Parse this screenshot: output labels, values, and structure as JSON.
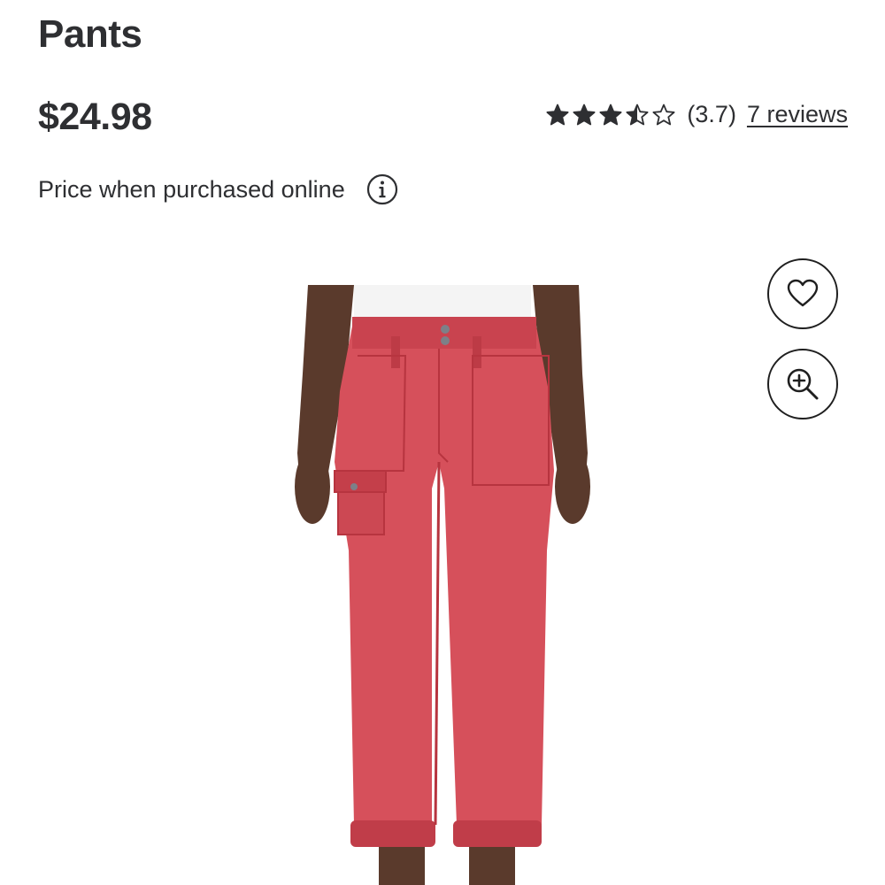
{
  "product": {
    "title": "Pants",
    "price": "$24.98",
    "price_note": "Price when purchased online",
    "image_alt": "Red corduroy cropped cargo pants"
  },
  "rating": {
    "value": 3.7,
    "display": "(3.7)",
    "reviews_link": "7 reviews",
    "max_stars": 5
  },
  "icons": {
    "info": "info-icon",
    "favorite": "heart-icon",
    "zoom": "zoom-in-icon",
    "star_filled": "star-filled-icon",
    "star_half": "star-half-icon",
    "star_empty": "star-empty-icon"
  },
  "colors": {
    "text": "#2e2f32",
    "pants": "#d6505b",
    "skin": "#5a3a2c"
  }
}
